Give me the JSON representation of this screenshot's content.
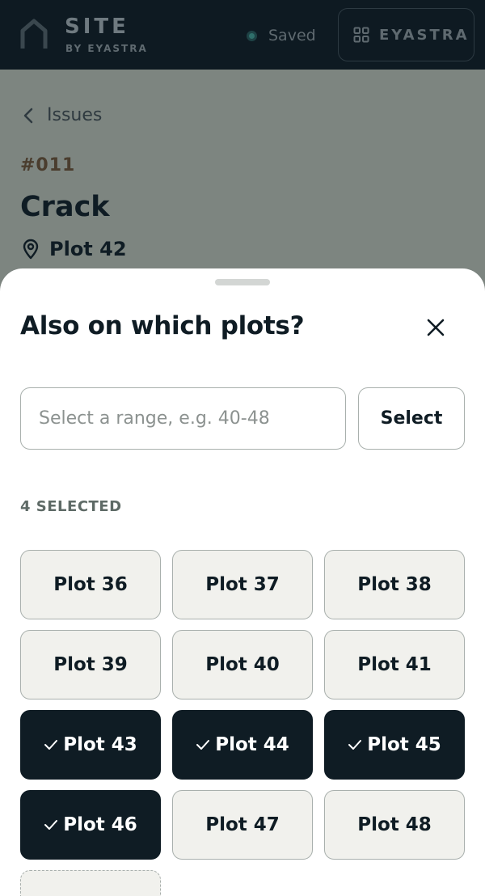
{
  "header": {
    "brand_title": "SITE",
    "brand_subtitle": "BY EYASTRA",
    "saved_label": "Saved",
    "workspace_label": "EYASTRA"
  },
  "issue": {
    "back_label": "Issues",
    "id": "#011",
    "title": "Crack",
    "location": "Plot 42"
  },
  "sheet": {
    "title": "Also on which plots?",
    "range_input": {
      "value": "",
      "placeholder": "Select a range, e.g. 40-48"
    },
    "select_button_label": "Select",
    "selected_count_label": "4 SELECTED",
    "plots": [
      {
        "label": "Plot 36",
        "selected": false
      },
      {
        "label": "Plot 37",
        "selected": false
      },
      {
        "label": "Plot 38",
        "selected": false
      },
      {
        "label": "Plot 39",
        "selected": false
      },
      {
        "label": "Plot 40",
        "selected": false
      },
      {
        "label": "Plot 41",
        "selected": false
      },
      {
        "label": "Plot 43",
        "selected": true
      },
      {
        "label": "Plot 44",
        "selected": true
      },
      {
        "label": "Plot 45",
        "selected": true
      },
      {
        "label": "Plot 46",
        "selected": true
      },
      {
        "label": "Plot 47",
        "selected": false
      },
      {
        "label": "Plot 48",
        "selected": false
      }
    ]
  },
  "colors": {
    "dark": "#0f1c24",
    "overlay": "#7d8580",
    "tile_bg": "#f1f1ed",
    "tile_border": "#a9b0ad",
    "saved_dot": "#2f6f6b"
  },
  "icons": [
    "app-logo-icon",
    "saved-dot-icon",
    "grid-icon",
    "chevron-left-icon",
    "location-pin-icon",
    "close-icon",
    "check-icon"
  ]
}
